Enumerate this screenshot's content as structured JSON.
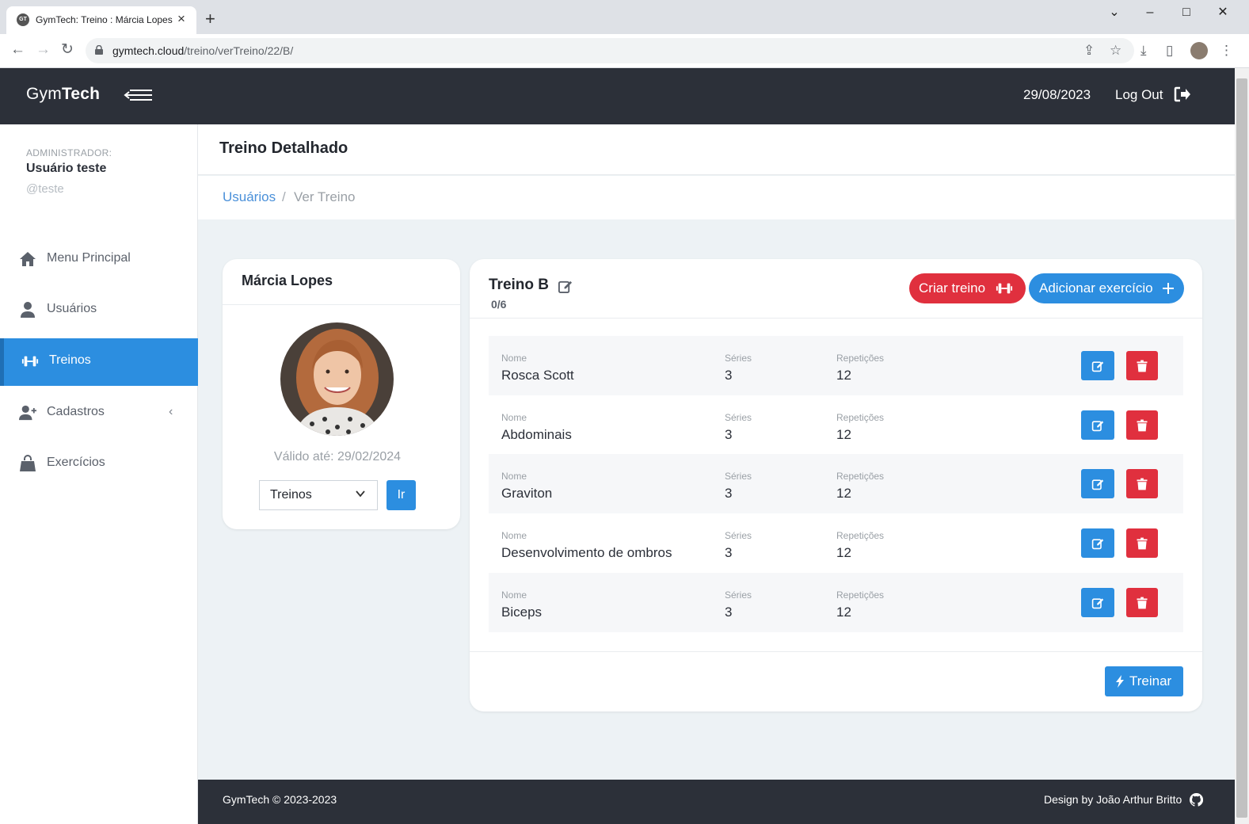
{
  "browser": {
    "tab_title": "GymTech: Treino : Márcia Lopes",
    "favicon_text": "GT",
    "url_domain": "gymtech.cloud",
    "url_path": "/treino/verTreino/22/B/"
  },
  "header": {
    "brand_light": "Gym",
    "brand_bold": "Tech",
    "date": "29/08/2023",
    "logout_label": "Log Out"
  },
  "sidebar": {
    "role": "ADMINISTRADOR:",
    "user_name": "Usuário teste",
    "user_handle": "@teste",
    "items": [
      {
        "label": "Menu Principal",
        "icon": "home-icon"
      },
      {
        "label": "Usuários",
        "icon": "user-icon"
      },
      {
        "label": "Treinos",
        "icon": "dumbbell-icon",
        "active": true
      },
      {
        "label": "Cadastros",
        "icon": "user-plus-icon"
      },
      {
        "label": "Exercícios",
        "icon": "bag-icon"
      }
    ]
  },
  "page": {
    "title": "Treino Detalhado",
    "breadcrumb": [
      "Usuários",
      "Ver Treino"
    ],
    "breadcrumb_sep": "/"
  },
  "profile": {
    "name": "Márcia Lopes",
    "valid_until": "Válido até: 29/02/2024",
    "select_value": "Treinos",
    "go_label": "Ir"
  },
  "workout": {
    "title": "Treino B",
    "progress": "0/6",
    "create_label": "Criar treino",
    "add_label": "Adicionar exercício",
    "col_name": "Nome",
    "col_series": "Séries",
    "col_reps": "Repetições",
    "exercises": [
      {
        "name": "Rosca Scott",
        "series": "3",
        "reps": "12"
      },
      {
        "name": "Abdominais",
        "series": "3",
        "reps": "12"
      },
      {
        "name": "Graviton",
        "series": "3",
        "reps": "12"
      },
      {
        "name": "Desenvolvimento de ombros",
        "series": "3",
        "reps": "12"
      },
      {
        "name": "Biceps",
        "series": "3",
        "reps": "12"
      }
    ],
    "train_label": "Treinar"
  },
  "footer": {
    "left": "GymTech © 2023-2023",
    "right": "Design by João Arthur Britto"
  },
  "colors": {
    "primary": "#2c8ee0",
    "danger": "#e0303e",
    "dark": "#2c3039",
    "background": "#edf2f5"
  }
}
